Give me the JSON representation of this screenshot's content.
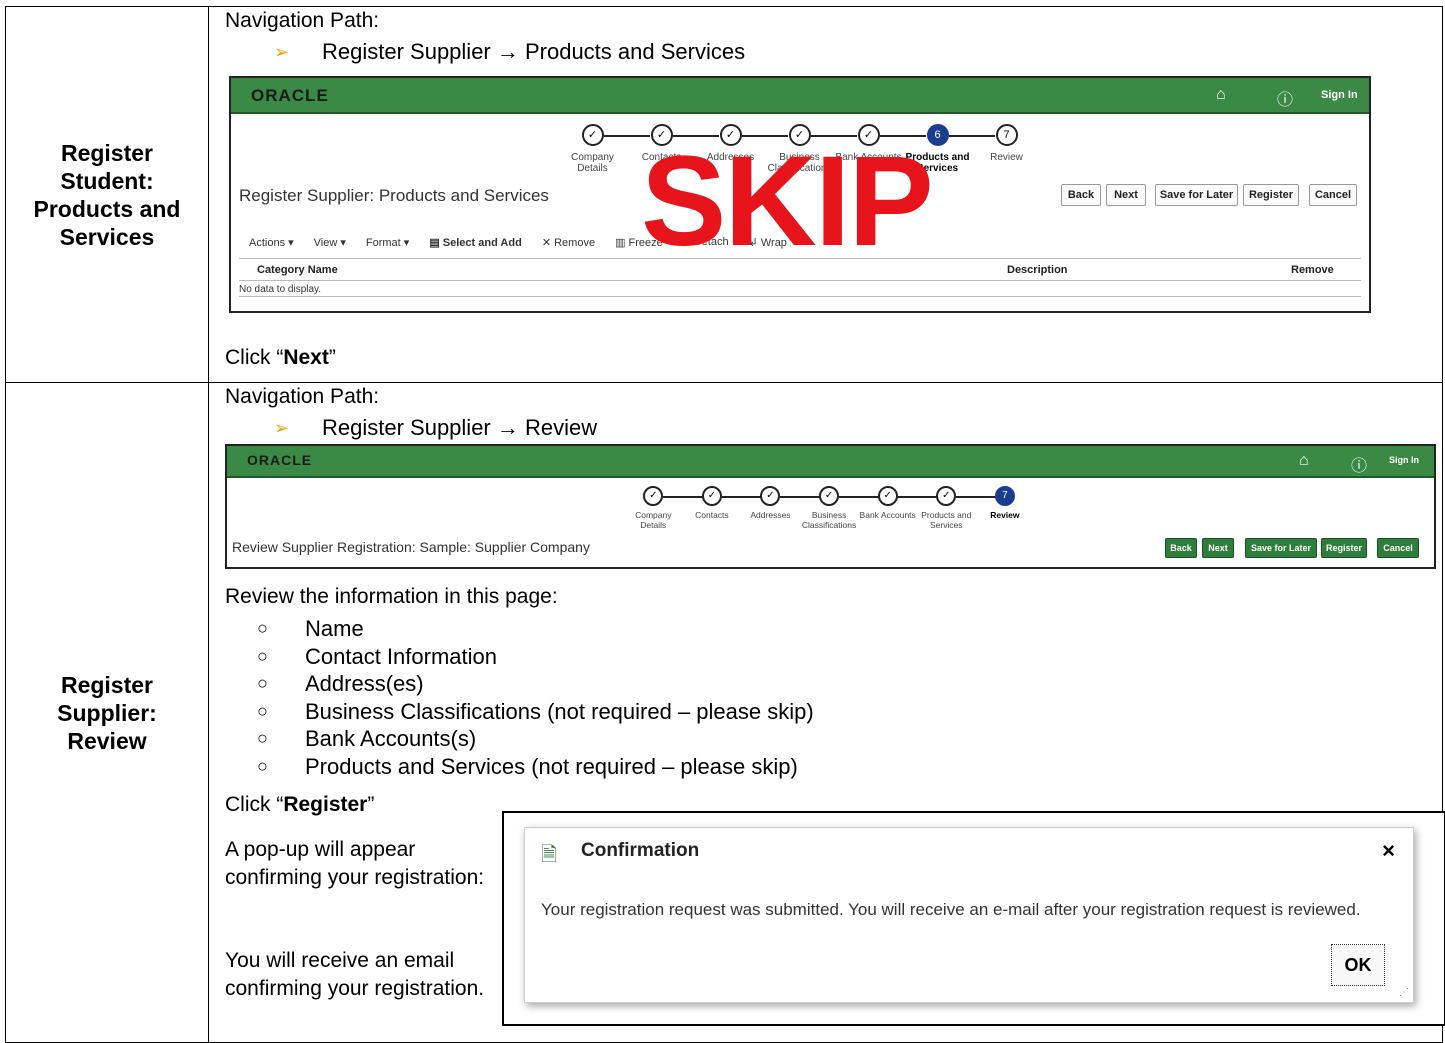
{
  "rows": [
    {
      "label": "Register Student: Products and Services",
      "nav_heading": "Navigation Path:",
      "nav_path": "Register Supplier → Products and Services",
      "screenshot": {
        "logo": "ORACLE",
        "sign_in": "Sign In",
        "steps": [
          {
            "num": "✓",
            "label": "Company Details"
          },
          {
            "num": "✓",
            "label": "Contacts"
          },
          {
            "num": "✓",
            "label": "Addresses"
          },
          {
            "num": "✓",
            "label": "Business Classifications"
          },
          {
            "num": "✓",
            "label": "Bank Accounts"
          },
          {
            "num": "6",
            "label": "Products and Services",
            "active": true
          },
          {
            "num": "7",
            "label": "Review"
          }
        ],
        "title": "Register Supplier: Products and Services",
        "buttons": [
          "Back",
          "Next",
          "Save for Later",
          "Register",
          "Cancel"
        ],
        "toolbar": [
          "Actions ▾",
          "View ▾",
          "Format ▾",
          "Select and Add",
          "Remove",
          "Freeze",
          "Detach",
          "Wrap"
        ],
        "columns": [
          "Category Name",
          "Description",
          "Remove"
        ],
        "empty_text": "No data to display.",
        "overlay": "SKIP"
      },
      "instruction_prefix": "Click “",
      "instruction_bold": "Next",
      "instruction_suffix": "”"
    },
    {
      "label": "Register Supplier: Review",
      "nav_heading": "Navigation Path:",
      "nav_path": "Register Supplier → Review",
      "screenshot": {
        "logo": "ORACLE",
        "sign_in": "Sign In",
        "steps": [
          {
            "num": "✓",
            "label": "Company Details"
          },
          {
            "num": "✓",
            "label": "Contacts"
          },
          {
            "num": "✓",
            "label": "Addresses"
          },
          {
            "num": "✓",
            "label": "Business Classifications"
          },
          {
            "num": "✓",
            "label": "Bank Accounts"
          },
          {
            "num": "✓",
            "label": "Products and Services"
          },
          {
            "num": "7",
            "label": "Review",
            "active": true
          }
        ],
        "title": "Review Supplier Registration: Sample: Supplier Company",
        "buttons": [
          "Back",
          "Next",
          "Save for Later",
          "Register",
          "Cancel"
        ]
      },
      "review_intro": "Review the information in this page:",
      "review_items": [
        "Name",
        "Contact Information",
        "Address(es)",
        "Business Classifications (not required – please skip)",
        "Bank Accounts(s)",
        "Products and Services (not required – please skip)"
      ],
      "instruction_prefix": "Click “",
      "instruction_bold": "Register",
      "instruction_suffix": "”",
      "popup_text": "A pop-up will appear confirming your registration:",
      "email_text": "You will receive an email confirming your registration.",
      "dialog": {
        "title": "Confirmation",
        "close": "×",
        "message": "Your registration request was submitted. You will receive an e-mail after your registration request is reviewed.",
        "ok": "OK"
      }
    }
  ]
}
